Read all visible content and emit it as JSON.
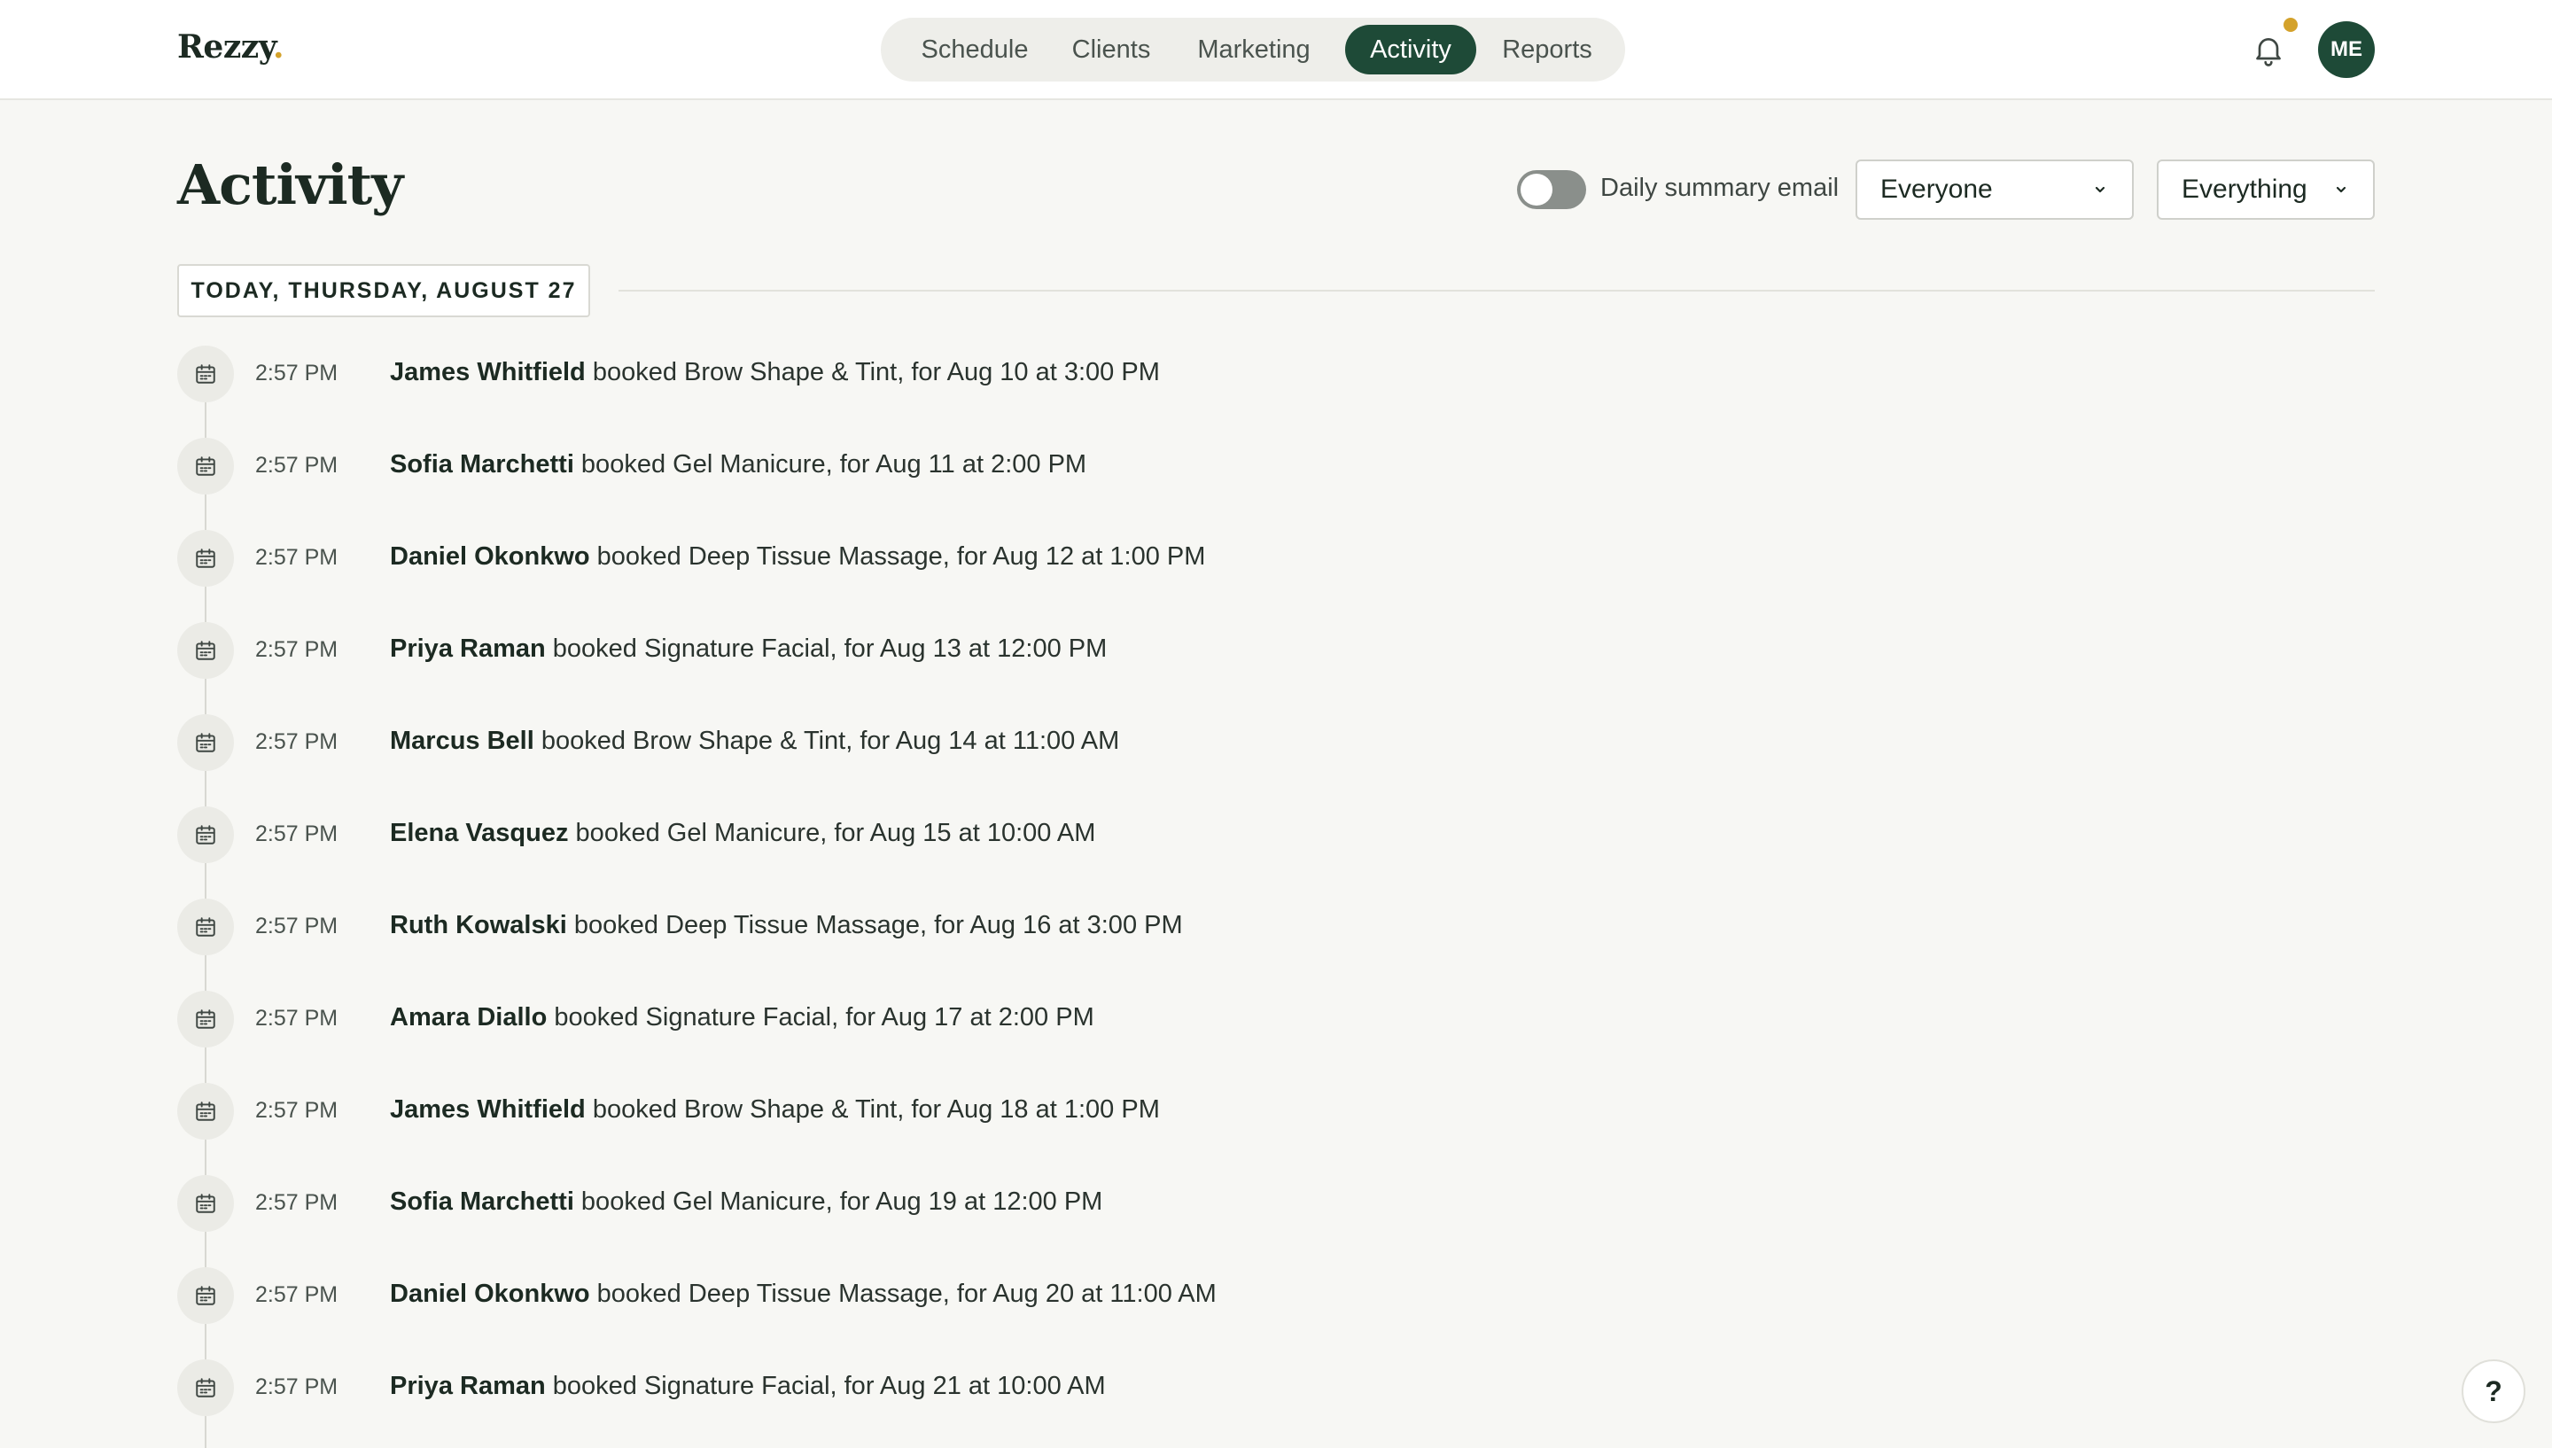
{
  "brand": {
    "name": "Rezzy",
    "dot": "."
  },
  "nav": {
    "tabs": [
      {
        "label": "Schedule"
      },
      {
        "label": "Clients"
      },
      {
        "label": "Marketing"
      },
      {
        "label": "Activity",
        "active": true
      },
      {
        "label": "Reports"
      }
    ]
  },
  "user": {
    "initials": "ME",
    "has_notification": true
  },
  "page": {
    "title": "Activity",
    "summary_toggle_label": "Daily summary email",
    "summary_toggle_on": false,
    "filter_people": "Everyone",
    "filter_type": "Everything",
    "date_heading": "TODAY, THURSDAY, AUGUST 27"
  },
  "activity": [
    {
      "time": "2:57 PM",
      "client": "James Whitfield",
      "text": " booked Brow Shape & Tint, for Aug 10 at 3:00 PM"
    },
    {
      "time": "2:57 PM",
      "client": "Sofia Marchetti",
      "text": " booked Gel Manicure, for Aug 11 at 2:00 PM"
    },
    {
      "time": "2:57 PM",
      "client": "Daniel Okonkwo",
      "text": " booked Deep Tissue Massage, for Aug 12 at 1:00 PM"
    },
    {
      "time": "2:57 PM",
      "client": "Priya Raman",
      "text": " booked Signature Facial, for Aug 13 at 12:00 PM"
    },
    {
      "time": "2:57 PM",
      "client": "Marcus Bell",
      "text": " booked Brow Shape & Tint, for Aug 14 at 11:00 AM"
    },
    {
      "time": "2:57 PM",
      "client": "Elena Vasquez",
      "text": " booked Gel Manicure, for Aug 15 at 10:00 AM"
    },
    {
      "time": "2:57 PM",
      "client": "Ruth Kowalski",
      "text": " booked Deep Tissue Massage, for Aug 16 at 3:00 PM"
    },
    {
      "time": "2:57 PM",
      "client": "Amara Diallo",
      "text": " booked Signature Facial, for Aug 17 at 2:00 PM"
    },
    {
      "time": "2:57 PM",
      "client": "James Whitfield",
      "text": " booked Brow Shape & Tint, for Aug 18 at 1:00 PM"
    },
    {
      "time": "2:57 PM",
      "client": "Sofia Marchetti",
      "text": " booked Gel Manicure, for Aug 19 at 12:00 PM"
    },
    {
      "time": "2:57 PM",
      "client": "Daniel Okonkwo",
      "text": " booked Deep Tissue Massage, for Aug 20 at 11:00 AM"
    },
    {
      "time": "2:57 PM",
      "client": "Priya Raman",
      "text": " booked Signature Facial, for Aug 21 at 10:00 AM"
    }
  ],
  "help_label": "?",
  "colors": {
    "accent": "#1e4a37",
    "notification": "#d4a22b",
    "background": "#f7f7f4"
  },
  "icons": {
    "row": "calendar-icon",
    "bell": "bell-icon",
    "select": "chevron-down-icon"
  }
}
